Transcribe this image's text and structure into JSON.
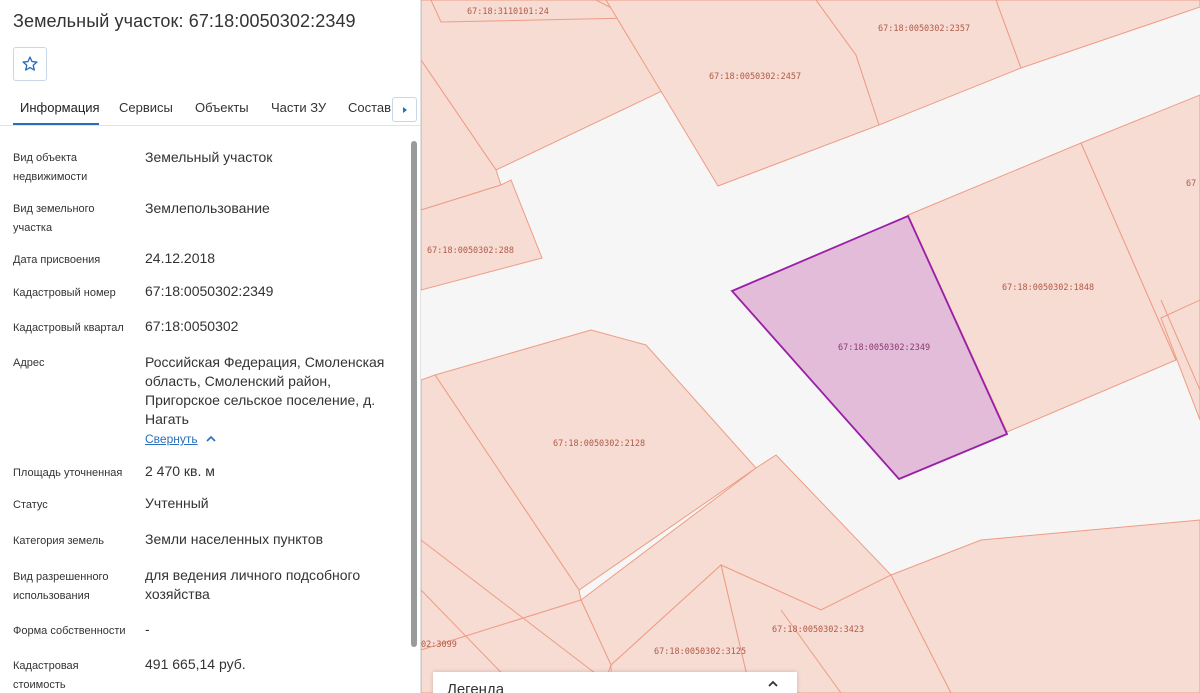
{
  "panel": {
    "title": "Земельный участок: 67:18:0050302:2349",
    "favorite_icon": "star-icon",
    "tabs": [
      "Информация",
      "Сервисы",
      "Объекты",
      "Части ЗУ",
      "Состав"
    ],
    "active_tab": "Информация",
    "tab_scroll_icon": "triangle-right-icon",
    "rows": [
      {
        "label": "Вид объекта недвижимости",
        "value": "Земельный участок"
      },
      {
        "label": "Вид земельного участка",
        "value": "Землепользование"
      },
      {
        "label": "Дата присвоения",
        "value": "24.12.2018"
      },
      {
        "label": "Кадастровый номер",
        "value": "67:18:0050302:2349"
      },
      {
        "label": "Кадастровый квартал",
        "value": "67:18:0050302"
      },
      {
        "label": "Адрес",
        "value": "Российская Федерация, Смоленская область, Смоленский район, Пригорское сельское поселение, д. Нагать"
      },
      {
        "label": "Площадь уточненная",
        "value": "2 470 кв. м"
      },
      {
        "label": "Статус",
        "value": "Учтенный"
      },
      {
        "label": "Категория земель",
        "value": "Земли населенных пунктов"
      },
      {
        "label": "Вид разрешенного использования",
        "value": "для ведения личного подсобного хозяйства"
      },
      {
        "label": "Форма собственности",
        "value": "-"
      },
      {
        "label": "Кадастровая стоимость",
        "value": "491 665,14 руб."
      }
    ],
    "collapse_link": "Свернуть"
  },
  "map": {
    "selected_parcel": "67:18:0050302:2349",
    "labels": [
      "67:18:3110101:24",
      "67:18:0050302:2357",
      "67:18:0050302:2457",
      "67:18:0050302:288",
      "67:18:0050302:1848",
      "67:18:0050302:2349",
      "67:18:0050302:2128",
      "67:18:0050302:3423",
      "67:18:0050302:3125",
      "02:3099",
      "67"
    ],
    "colors": {
      "parcel_fill": "#f7dcd3",
      "parcel_stroke": "#ee9c85",
      "selected_fill": "#e3bcd9",
      "selected_stroke": "#9a1fa8",
      "background": "#f6f6f6"
    }
  },
  "legend": {
    "title": "Легенда",
    "toggle_icon": "chevron-up-icon"
  }
}
